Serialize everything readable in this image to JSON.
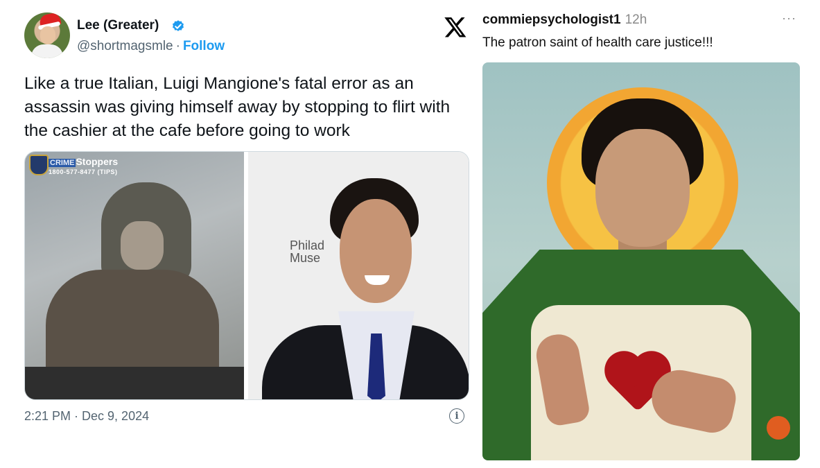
{
  "tweet": {
    "display_name": "Lee (Greater)",
    "handle": "@shortmagsmle",
    "separator": "·",
    "follow_label": "Follow",
    "text": "Like a true Italian, Luigi Mangione's fatal error as an assassin was giving himself away by stopping to flirt with the cashier at the cafe before going to work",
    "media": {
      "left_image": {
        "overlay_title_prefix": "CRIME",
        "overlay_title_suffix": "Stoppers",
        "overlay_phone": "1800-577-8477 (TIPS)"
      },
      "right_image": {
        "backdrop_text_1": "Philad",
        "backdrop_text_2": "Muse"
      }
    },
    "timestamp": "2:21 PM · Dec 9, 2024",
    "info_icon_glyph": "i"
  },
  "post": {
    "platform_icon": "x-logo-icon",
    "username": "commiepsychologist1",
    "time_ago": "12h",
    "more_glyph": "···",
    "caption": "The patron saint of health care justice!!!"
  },
  "colors": {
    "link_blue": "#1d9bf0",
    "muted_text": "#536471",
    "halo_gold": "#f6c244",
    "robe_green": "#2f6a2a"
  }
}
